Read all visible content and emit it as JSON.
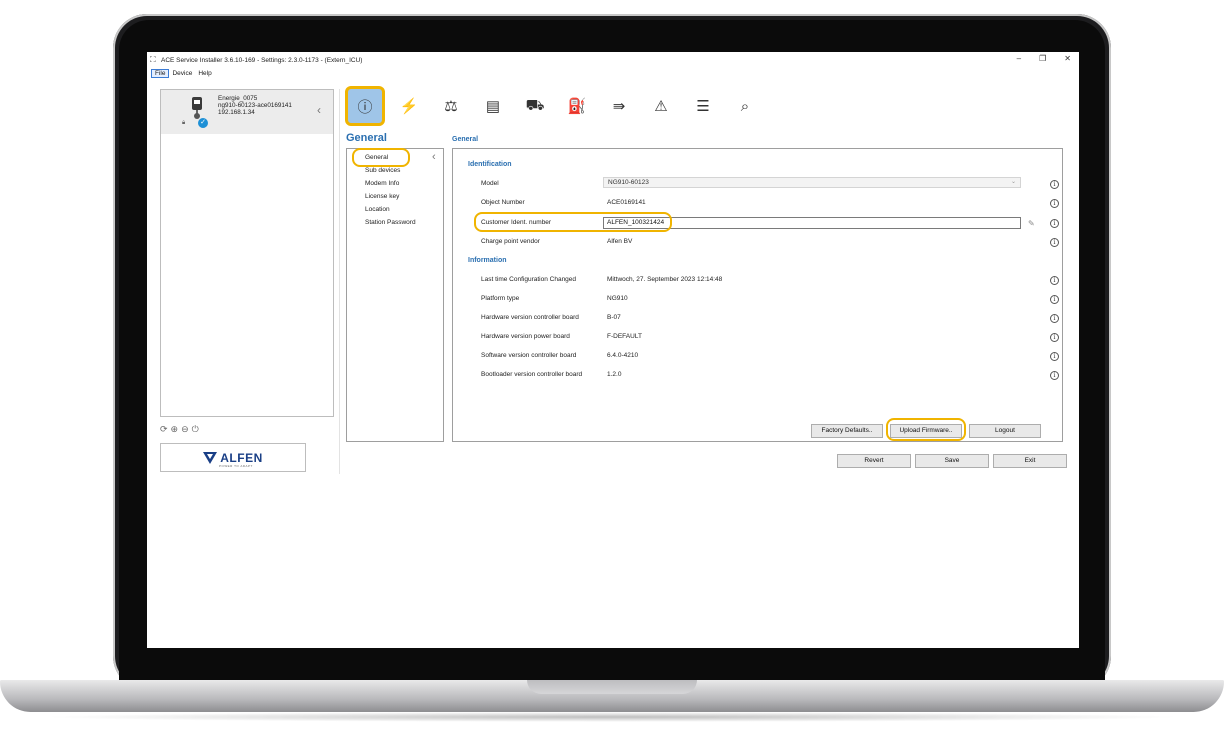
{
  "window": {
    "title": "ACE Service Installer 3.6.10-169 - Settings: 2.3.0-1173 - (Extern_ICU)",
    "minimize": "–",
    "maximize": "❐",
    "close": "✕"
  },
  "menu": [
    "File",
    "Device",
    "Help"
  ],
  "device": {
    "name": "Energie_0075",
    "id": "ng910-60123-ace0169141",
    "ip": "192.168.1.34",
    "collapse": "‹"
  },
  "left_icons": [
    "⟳",
    "⊕",
    "⊖",
    "⏻"
  ],
  "logo": {
    "text": "ALFEN",
    "tagline": "POWER TO ADAPT"
  },
  "toolbar": [
    "ⓘ",
    "⚡",
    "⚖",
    "▤",
    "⛟",
    "⛽",
    "⇛",
    "⚠",
    "☰",
    "⌕"
  ],
  "section": {
    "title": "General"
  },
  "nav": [
    "General",
    "Sub devices",
    "Modem Info",
    "License key",
    "Location",
    "Station Password"
  ],
  "panel": {
    "title": "General",
    "identification_label": "Identification",
    "information_label": "Information",
    "info_glyph": "i",
    "model": {
      "label": "Model",
      "value": "NG910-60123"
    },
    "object_number": {
      "label": "Object Number",
      "value": "ACE0169141"
    },
    "customer_ident": {
      "label": "Customer Ident. number",
      "value": "ALFEN_100321424"
    },
    "vendor": {
      "label": "Charge point vendor",
      "value": "Alfen BV"
    },
    "info_rows": [
      {
        "label": "Last time Configuration Changed",
        "value": "Mittwoch, 27. September 2023 12:14:48"
      },
      {
        "label": "Platform type",
        "value": "NG910"
      },
      {
        "label": "Hardware version controller board",
        "value": "B-07"
      },
      {
        "label": "Hardware version power board",
        "value": "F-DEFAULT"
      },
      {
        "label": "Software version controller board",
        "value": "6.4.0-4210"
      },
      {
        "label": "Bootloader version controller board",
        "value": "1.2.0"
      }
    ]
  },
  "buttons": {
    "factory_defaults": "Factory Defaults..",
    "upload_firmware": "Upload Firmware..",
    "logout": "Logout",
    "revert": "Revert",
    "save": "Save",
    "exit": "Exit"
  },
  "colors": {
    "accent": "#2a6fb0",
    "highlight": "#f0b400",
    "selected_tool": "#9fc5e8",
    "brand": "#1a3f86"
  }
}
